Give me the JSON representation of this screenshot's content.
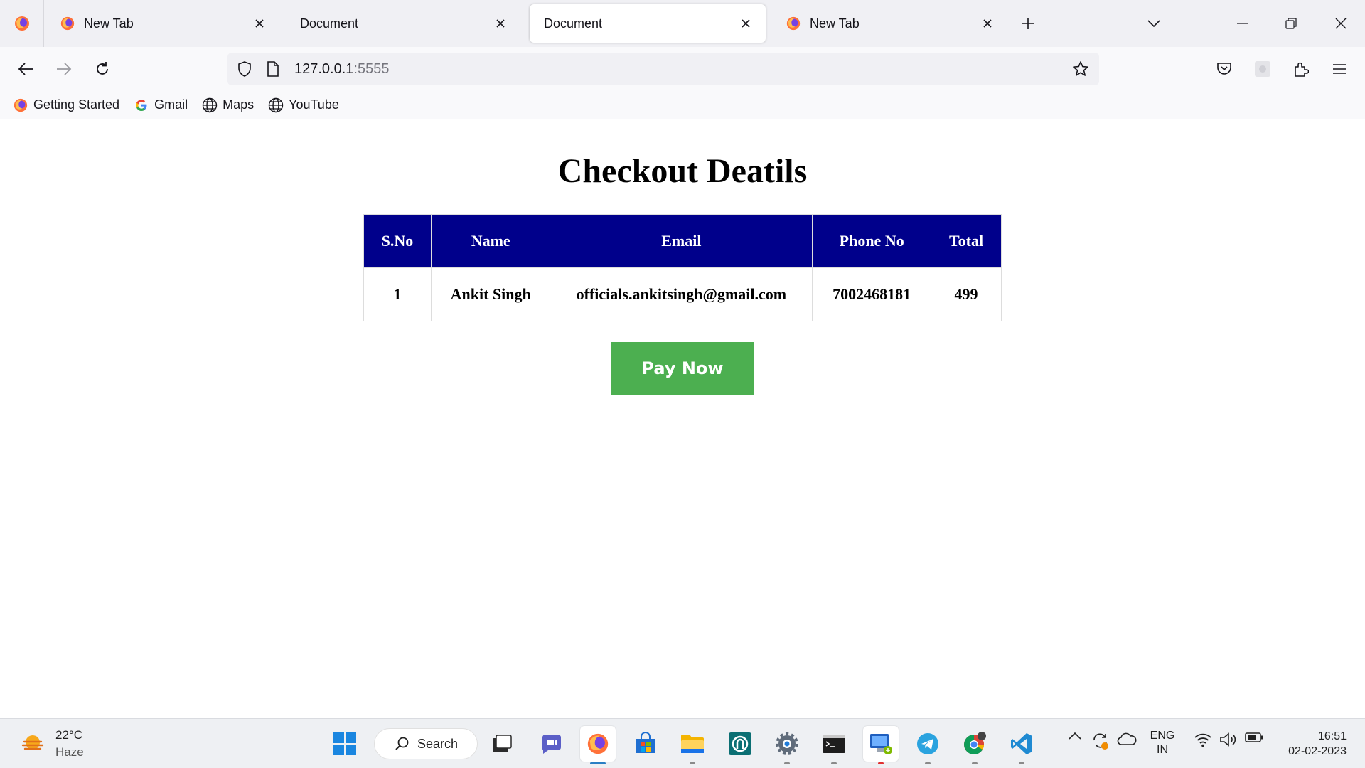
{
  "browser": {
    "tabs": [
      {
        "label": "New Tab",
        "favicon": "firefox-icon",
        "active": false
      },
      {
        "label": "Document",
        "favicon": "none",
        "active": false
      },
      {
        "label": "Document",
        "favicon": "none",
        "active": true
      },
      {
        "label": "New Tab",
        "favicon": "firefox-icon",
        "active": false
      }
    ],
    "url": {
      "host": "127.0.0.1",
      "port": ":5555"
    },
    "bookmarks": [
      {
        "label": "Getting Started",
        "icon": "firefox-icon"
      },
      {
        "label": "Gmail",
        "icon": "google-icon"
      },
      {
        "label": "Maps",
        "icon": "globe-icon"
      },
      {
        "label": "YouTube",
        "icon": "globe-icon"
      }
    ]
  },
  "page": {
    "title": "Checkout Deatils",
    "table": {
      "headers": [
        "S.No",
        "Name",
        "Email",
        "Phone No",
        "Total"
      ],
      "rows": [
        [
          "1",
          "Ankit Singh",
          "officials.ankitsingh@gmail.com",
          "7002468181",
          "499"
        ]
      ]
    },
    "pay_button": "Pay Now",
    "colors": {
      "header_bg": "#00008b",
      "button_bg": "#4caf50"
    }
  },
  "taskbar": {
    "weather": {
      "temp": "22°C",
      "condition": "Haze"
    },
    "search_label": "Search",
    "language": {
      "line1": "ENG",
      "line2": "IN"
    },
    "clock": {
      "time": "16:51",
      "date": "02-02-2023"
    }
  }
}
